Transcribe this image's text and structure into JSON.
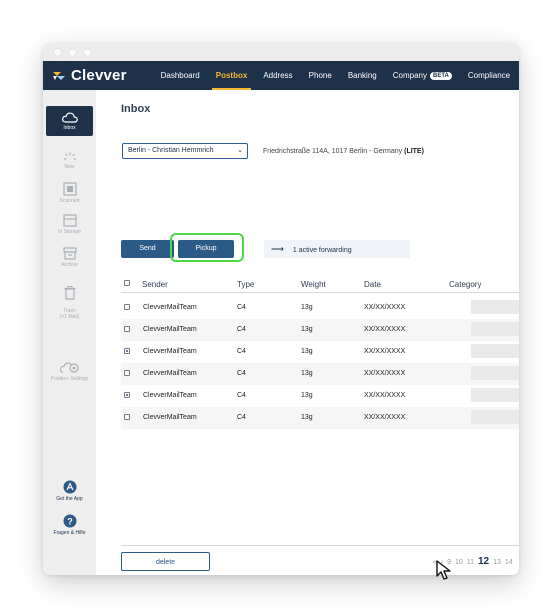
{
  "brand": {
    "name": "Clevver"
  },
  "nav": {
    "items": [
      {
        "label": "Dashboard"
      },
      {
        "label": "Postbox"
      },
      {
        "label": "Address"
      },
      {
        "label": "Phone"
      },
      {
        "label": "Banking"
      },
      {
        "label": "Company",
        "badge": "BETA"
      },
      {
        "label": "Compliance"
      }
    ]
  },
  "sidebar": {
    "items": [
      {
        "label": "Inbox",
        "icon": "cloud-icon"
      },
      {
        "label": "New",
        "icon": "spinner-icon"
      },
      {
        "label": "Scanned",
        "icon": "scan-icon"
      },
      {
        "label": "In Storage",
        "icon": "storage-icon"
      },
      {
        "label": "Archive",
        "icon": "archive-icon"
      },
      {
        "label": "Trash\n(>1 Mail)",
        "icon": "trash-icon"
      },
      {
        "label": "Postbox Settings",
        "icon": "settings-cloud-icon"
      },
      {
        "label": "Get the App",
        "icon": "app-icon"
      },
      {
        "label": "Fragen & Hilfe",
        "icon": "help-icon"
      }
    ]
  },
  "page": {
    "title": "Inbox"
  },
  "location": {
    "selected": "Berlin - Christian Hemmrich",
    "address": "Friedrichstraße 114A, 1017 Berlin - Germany",
    "plan": "(LITE)"
  },
  "actions": {
    "send": "Send",
    "pickup": "Pickup",
    "forwarding": "1 active forwarding",
    "delete": "delete"
  },
  "table": {
    "headers": [
      "Sender",
      "Type",
      "Weight",
      "Date",
      "Category"
    ],
    "rows": [
      {
        "sender": "ClevverMailTeam",
        "type": "C4",
        "weight": "13g",
        "date": "XX/XX/XXXX",
        "checked": false
      },
      {
        "sender": "ClevverMailTeam",
        "type": "C4",
        "weight": "13g",
        "date": "XX/XX/XXXX",
        "checked": false
      },
      {
        "sender": "ClevverMailTeam",
        "type": "C4",
        "weight": "13g",
        "date": "XX/XX/XXXX",
        "checked": true
      },
      {
        "sender": "ClevverMailTeam",
        "type": "C4",
        "weight": "13g",
        "date": "XX/XX/XXXX",
        "checked": false
      },
      {
        "sender": "ClevverMailTeam",
        "type": "C4",
        "weight": "13g",
        "date": "XX/XX/XXXX",
        "checked": true
      },
      {
        "sender": "ClevverMailTeam",
        "type": "C4",
        "weight": "13g",
        "date": "XX/XX/XXXX",
        "checked": false
      }
    ]
  },
  "pagination": {
    "first": "«",
    "prev": "‹",
    "pages": [
      "9",
      "10",
      "11",
      "12",
      "13",
      "14"
    ],
    "current": "12"
  },
  "colors": {
    "navy": "#1d3149",
    "accent": "#f7b733",
    "button": "#2c5a87",
    "highlight": "#4cd84e"
  }
}
